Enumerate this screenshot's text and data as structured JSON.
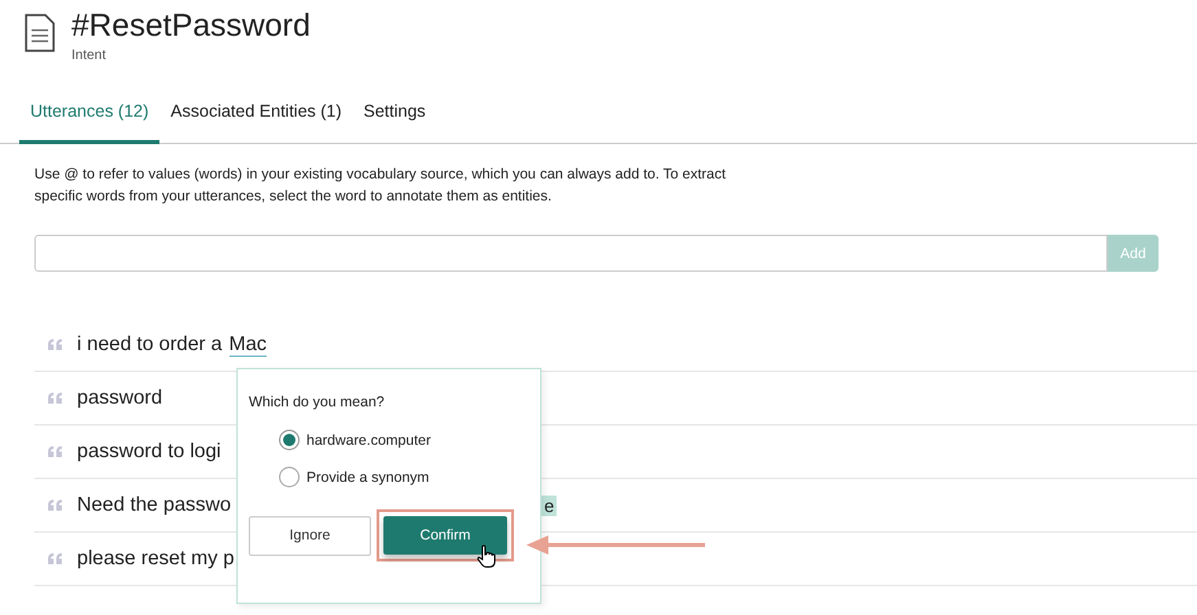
{
  "header": {
    "title": "#ResetPassword",
    "subtitle": "Intent"
  },
  "tabs": [
    {
      "label": "Utterances (12)",
      "selected": true
    },
    {
      "label": "Associated Entities (1)",
      "selected": false
    },
    {
      "label": "Settings",
      "selected": false
    }
  ],
  "help_text": "Use @ to refer to values (words) in your existing vocabulary source, which you can always add to. To extract specific words from your utterances, select the word to annotate them as entities.",
  "new_utterance": {
    "add_button": "Add",
    "add_disabled": true
  },
  "utterances": [
    {
      "text": "i need to order a",
      "annotated": "Mac"
    },
    {
      "text": "password"
    },
    {
      "text": "password to logi"
    },
    {
      "text": "Need the passwo",
      "entity_fragment": "e"
    },
    {
      "text": "please reset my p"
    }
  ],
  "popover": {
    "question": "Which do you mean?",
    "options": [
      {
        "label": "hardware.computer",
        "selected": true
      },
      {
        "label": "Provide a synonym",
        "selected": false
      }
    ],
    "buttons": [
      {
        "label": "Ignore",
        "kind": "secondary"
      },
      {
        "label": "Confirm",
        "kind": "primary"
      }
    ]
  }
}
